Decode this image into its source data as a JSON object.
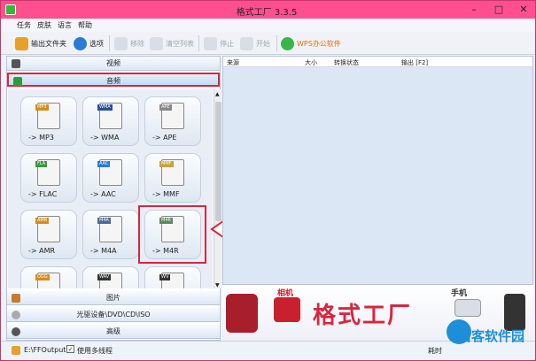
{
  "window": {
    "title": "格式工厂 3.3.5"
  },
  "menu": [
    "任务",
    "皮肤",
    "语言",
    "帮助"
  ],
  "toolbar": {
    "output_folder": "输出文件夹",
    "options": "选项",
    "remove": "移除",
    "clear_list": "清空列表",
    "stop": "停止",
    "start": "开始",
    "wps": "WPS办公软件"
  },
  "categories": {
    "video": "视频",
    "audio": "音频",
    "image": "图片",
    "rom": "光驱设备\\DVD\\CD\\ISO",
    "advanced": "高级"
  },
  "formats": [
    {
      "badge": "MP3",
      "label": "-> MP3"
    },
    {
      "badge": "WMA",
      "label": "-> WMA"
    },
    {
      "badge": "APE",
      "label": "-> APE"
    },
    {
      "badge": "FLA",
      "label": "-> FLAC"
    },
    {
      "badge": "AAC",
      "label": "-> AAC"
    },
    {
      "badge": "MMF",
      "label": "-> MMF"
    },
    {
      "badge": "AMR",
      "label": "-> AMR"
    },
    {
      "badge": "M4A",
      "label": "-> M4A"
    },
    {
      "badge": "M4R",
      "label": "-> M4R"
    },
    {
      "badge": "OGG",
      "label": ""
    },
    {
      "badge": "WAV",
      "label": ""
    },
    {
      "badge": "WV",
      "label": ""
    }
  ],
  "task_list": {
    "columns": [
      "来源",
      "大小",
      "转换状态",
      "输出 [F2]"
    ]
  },
  "banner": {
    "brand": "格式工厂",
    "camera": "相机",
    "phone": "手机"
  },
  "status": {
    "output_path": "E:\\FFOutput",
    "multithread": "使用多线程",
    "elapsed_label": "耗时"
  },
  "watermark": {
    "text": "当客软件园"
  },
  "colors": {
    "titlebar": "#ff4f8f",
    "highlight": "#d8263f",
    "accent": "#2a7bd5"
  }
}
